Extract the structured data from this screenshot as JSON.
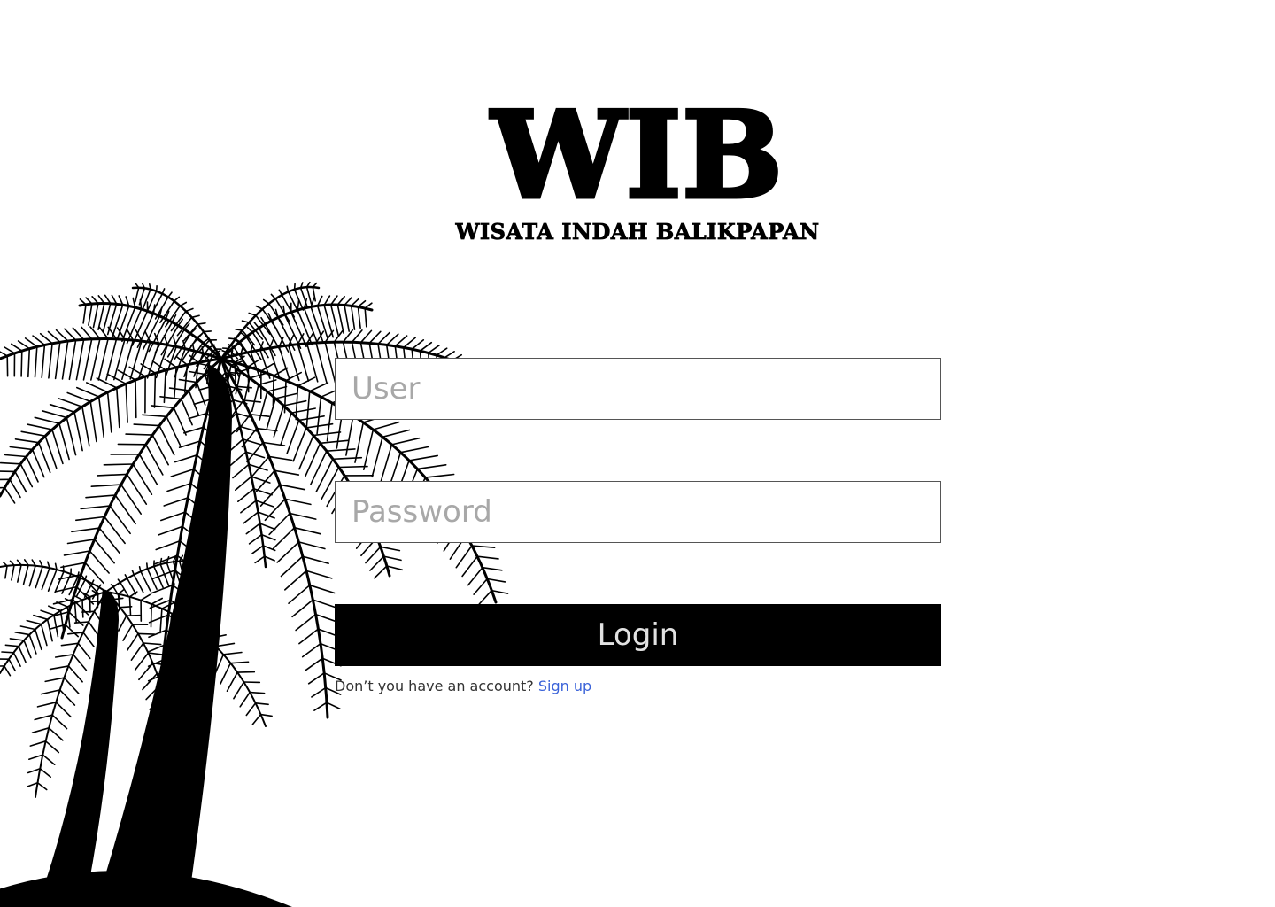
{
  "brand": {
    "logo": "WIB",
    "tagline": "WISATA INDAH BALIKPAPAN"
  },
  "form": {
    "user_placeholder": "User",
    "password_placeholder": "Password",
    "login_label": "Login"
  },
  "signup": {
    "prompt": "Don’t you have an account?",
    "link_label": "Sign up"
  },
  "colors": {
    "background": "#ffffff",
    "primary": "#000000",
    "link": "#3b63d9",
    "placeholder": "#a8a8a8"
  }
}
